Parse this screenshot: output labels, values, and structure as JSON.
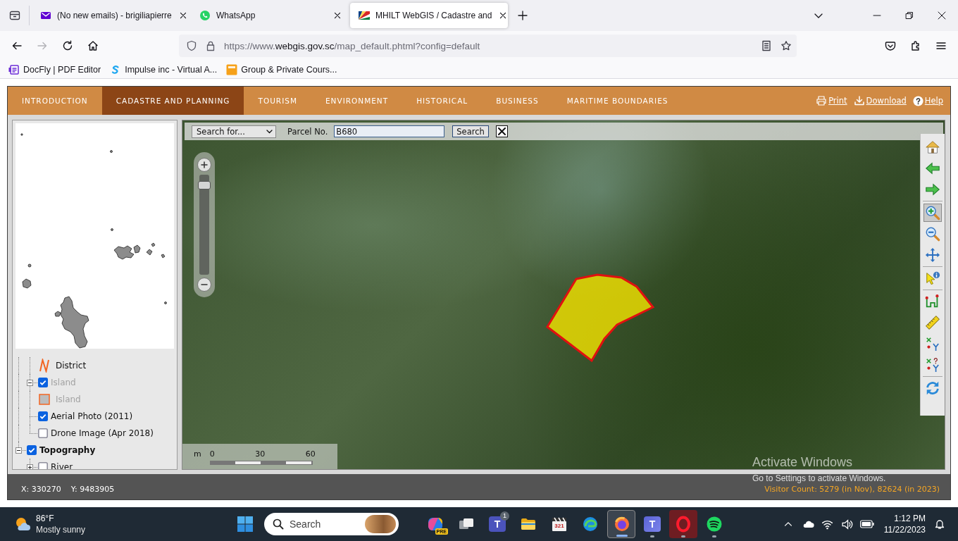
{
  "browser": {
    "tabs": [
      {
        "kind": "mail",
        "title": "(No new emails) - brigiliapierre",
        "selected": false
      },
      {
        "kind": "whatsapp",
        "title": "WhatsApp",
        "selected": false
      },
      {
        "kind": "flag",
        "title": "MHILT WebGIS / Cadastre and",
        "selected": true
      }
    ],
    "url": {
      "prefix": "https://www.",
      "domain": "webgis.gov.sc",
      "path": "/map_default.phtml?config=default"
    },
    "bookmarks": [
      {
        "kind": "docfly",
        "label": "DocFly | PDF Editor"
      },
      {
        "kind": "impulse",
        "label": "Impulse inc - Virtual A..."
      },
      {
        "kind": "euro",
        "label": "Group & Private Cours..."
      }
    ]
  },
  "nav": {
    "tabs": [
      {
        "label": "INTRODUCTION",
        "selected": false
      },
      {
        "label": "CADASTRE AND PLANNING",
        "selected": true
      },
      {
        "label": "TOURISM",
        "selected": false
      },
      {
        "label": "ENVIRONMENT",
        "selected": false
      },
      {
        "label": "HISTORICAL",
        "selected": false
      },
      {
        "label": "BUSINESS",
        "selected": false
      },
      {
        "label": "MARITIME BOUNDARIES",
        "selected": false
      }
    ],
    "links": [
      {
        "kind": "print",
        "label": "Print"
      },
      {
        "kind": "download",
        "label": "Download"
      },
      {
        "kind": "help",
        "label": "Help"
      }
    ]
  },
  "layer_tree": [
    {
      "kind": "group",
      "children": [
        {
          "kind": "lineLegend",
          "label": "District",
          "disabled": false
        },
        {
          "kind": "layer",
          "label": "Island",
          "checked": true,
          "disabled": true,
          "expanded": true,
          "children": [
            {
              "kind": "areaLegend",
              "label": "Island",
              "disabled": true
            }
          ]
        },
        {
          "kind": "layer",
          "label": "Aerial Photo (2011)",
          "checked": true,
          "disabled": false
        },
        {
          "kind": "layer",
          "label": "Drone Image (Apr 2018)",
          "checked": false,
          "disabled": false
        }
      ]
    },
    {
      "kind": "group",
      "label": "Topography",
      "checked": true,
      "expanded": true,
      "children": [
        {
          "kind": "layer",
          "label": "River",
          "checked": false,
          "disabled": false,
          "expanded": false
        }
      ]
    }
  ],
  "map": {
    "search": {
      "select": "Search for...",
      "label": "Parcel No.",
      "value": "B680",
      "button": "Search"
    },
    "zoom_slider": {
      "level": 0.93
    },
    "scale": {
      "unit": "m",
      "ticks": [
        "0",
        "30",
        "60"
      ]
    },
    "tool_groups": [
      {
        "tools": [
          {
            "kind": "home",
            "selected": false
          },
          {
            "kind": "back",
            "selected": false
          },
          {
            "kind": "forward",
            "selected": false
          }
        ]
      },
      {
        "tools": [
          {
            "kind": "zoomIn",
            "selected": true
          },
          {
            "kind": "zoomOut",
            "selected": false
          },
          {
            "kind": "pan",
            "selected": false
          }
        ]
      },
      {
        "tools": [
          {
            "kind": "identify",
            "selected": false
          }
        ]
      },
      {
        "tools": [
          {
            "kind": "route",
            "selected": false
          },
          {
            "kind": "measure",
            "selected": false
          },
          {
            "kind": "coordinates",
            "selected": false
          },
          {
            "kind": "coordinateQuery",
            "selected": false
          }
        ]
      },
      {
        "tools": [
          {
            "kind": "refresh",
            "selected": false
          }
        ]
      }
    ]
  },
  "status_bar": {
    "x": "X: 330270",
    "y": "Y: 9483905",
    "visitors": "Visitor Count: 5279 (in Nov), 82624 (in 2023)"
  },
  "os_watermark": {
    "title": "Activate Windows",
    "hint": "Go to Settings to activate Windows."
  },
  "taskbar": {
    "weather": {
      "temperature": "86°F",
      "condition": "Mostly sunny"
    },
    "search": {
      "placeholder": "Search"
    },
    "apps": [
      {
        "kind": "copilot",
        "badge": "PRE",
        "running": false,
        "selected": false,
        "attention": false
      },
      {
        "kind": "taskview",
        "running": false,
        "selected": false,
        "attention": false
      },
      {
        "kind": "teamsClassic",
        "glyph": "T",
        "badge": "1",
        "running": false,
        "selected": false,
        "attention": false
      },
      {
        "kind": "explorer",
        "running": false,
        "selected": false,
        "attention": false
      },
      {
        "kind": "media",
        "glyph": "321",
        "running": false,
        "selected": false,
        "attention": false
      },
      {
        "kind": "edge",
        "running": false,
        "selected": false,
        "attention": false
      },
      {
        "kind": "firefox",
        "running": true,
        "selected": true,
        "attention": false
      },
      {
        "kind": "teams",
        "glyph": "T",
        "running": true,
        "selected": false,
        "attention": false
      },
      {
        "kind": "opera",
        "running": true,
        "selected": false,
        "attention": true
      },
      {
        "kind": "spotify",
        "running": true,
        "selected": false,
        "attention": false
      }
    ],
    "clock": {
      "time": "1:12 PM",
      "date": "11/22/2023"
    }
  }
}
